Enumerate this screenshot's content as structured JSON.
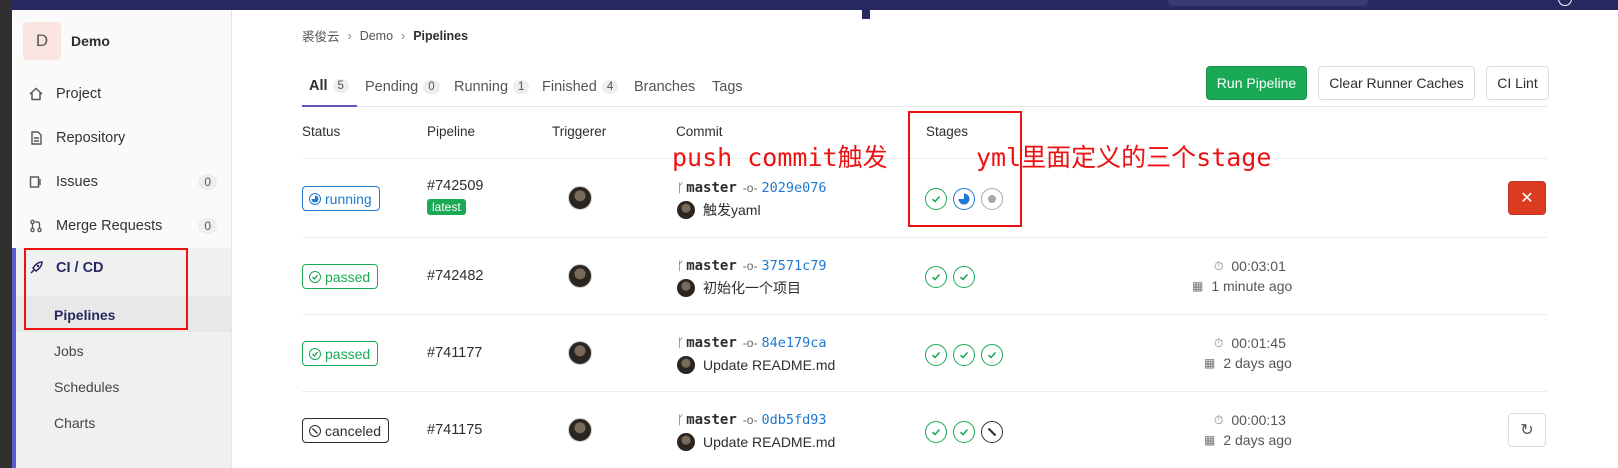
{
  "project": {
    "avatar_letter": "D",
    "name": "Demo"
  },
  "sidebar": {
    "items": [
      {
        "label": "Project",
        "icon": "home-icon"
      },
      {
        "label": "Repository",
        "icon": "doc-icon"
      },
      {
        "label": "Issues",
        "icon": "issues-icon",
        "count": "0"
      },
      {
        "label": "Merge Requests",
        "icon": "merge-request-icon",
        "count": "0"
      },
      {
        "label": "CI / CD",
        "icon": "rocket-icon"
      }
    ],
    "cicd_subitems": [
      "Pipelines",
      "Jobs",
      "Schedules",
      "Charts"
    ]
  },
  "breadcrumb": {
    "group": "裘俊云",
    "project": "Demo",
    "current": "Pipelines"
  },
  "tabs": [
    {
      "label": "All",
      "count": "5"
    },
    {
      "label": "Pending",
      "count": "0"
    },
    {
      "label": "Running",
      "count": "1"
    },
    {
      "label": "Finished",
      "count": "4"
    },
    {
      "label": "Branches"
    },
    {
      "label": "Tags"
    }
  ],
  "buttons": {
    "run_pipeline": "Run Pipeline",
    "clear_caches": "Clear Runner Caches",
    "ci_lint": "CI Lint"
  },
  "table": {
    "headers": [
      "Status",
      "Pipeline",
      "Triggerer",
      "Commit",
      "Stages"
    ],
    "rows": [
      {
        "status": "running",
        "pipeline_id": "#742509",
        "tag": "latest",
        "branch": "master",
        "sha": "2029e076",
        "message": "触发yaml",
        "stages": [
          "success",
          "running",
          "created"
        ]
      },
      {
        "status": "passed",
        "pipeline_id": "#742482",
        "branch": "master",
        "sha": "37571c79",
        "message": "初始化一个项目",
        "stages": [
          "success",
          "success"
        ],
        "duration": "00:03:01",
        "finished": "1 minute ago"
      },
      {
        "status": "passed",
        "pipeline_id": "#741177",
        "branch": "master",
        "sha": "84e179ca",
        "message": "Update README.md",
        "stages": [
          "success",
          "success",
          "success"
        ],
        "duration": "00:01:45",
        "finished": "2 days ago"
      },
      {
        "status": "canceled",
        "pipeline_id": "#741175",
        "branch": "master",
        "sha": "0db5fd93",
        "message": "Update README.md",
        "stages": [
          "success",
          "success",
          "canceled"
        ],
        "duration": "00:00:13",
        "finished": "2 days ago"
      }
    ]
  },
  "annotations": {
    "commit_note": "push commit触发",
    "stage_note": "yml里面定义的三个stage"
  },
  "colors": {
    "accent": "#292961",
    "success": "#1aaa55",
    "running": "#1f78d1",
    "danger": "#db3b21",
    "annotation": "#ee1111"
  }
}
